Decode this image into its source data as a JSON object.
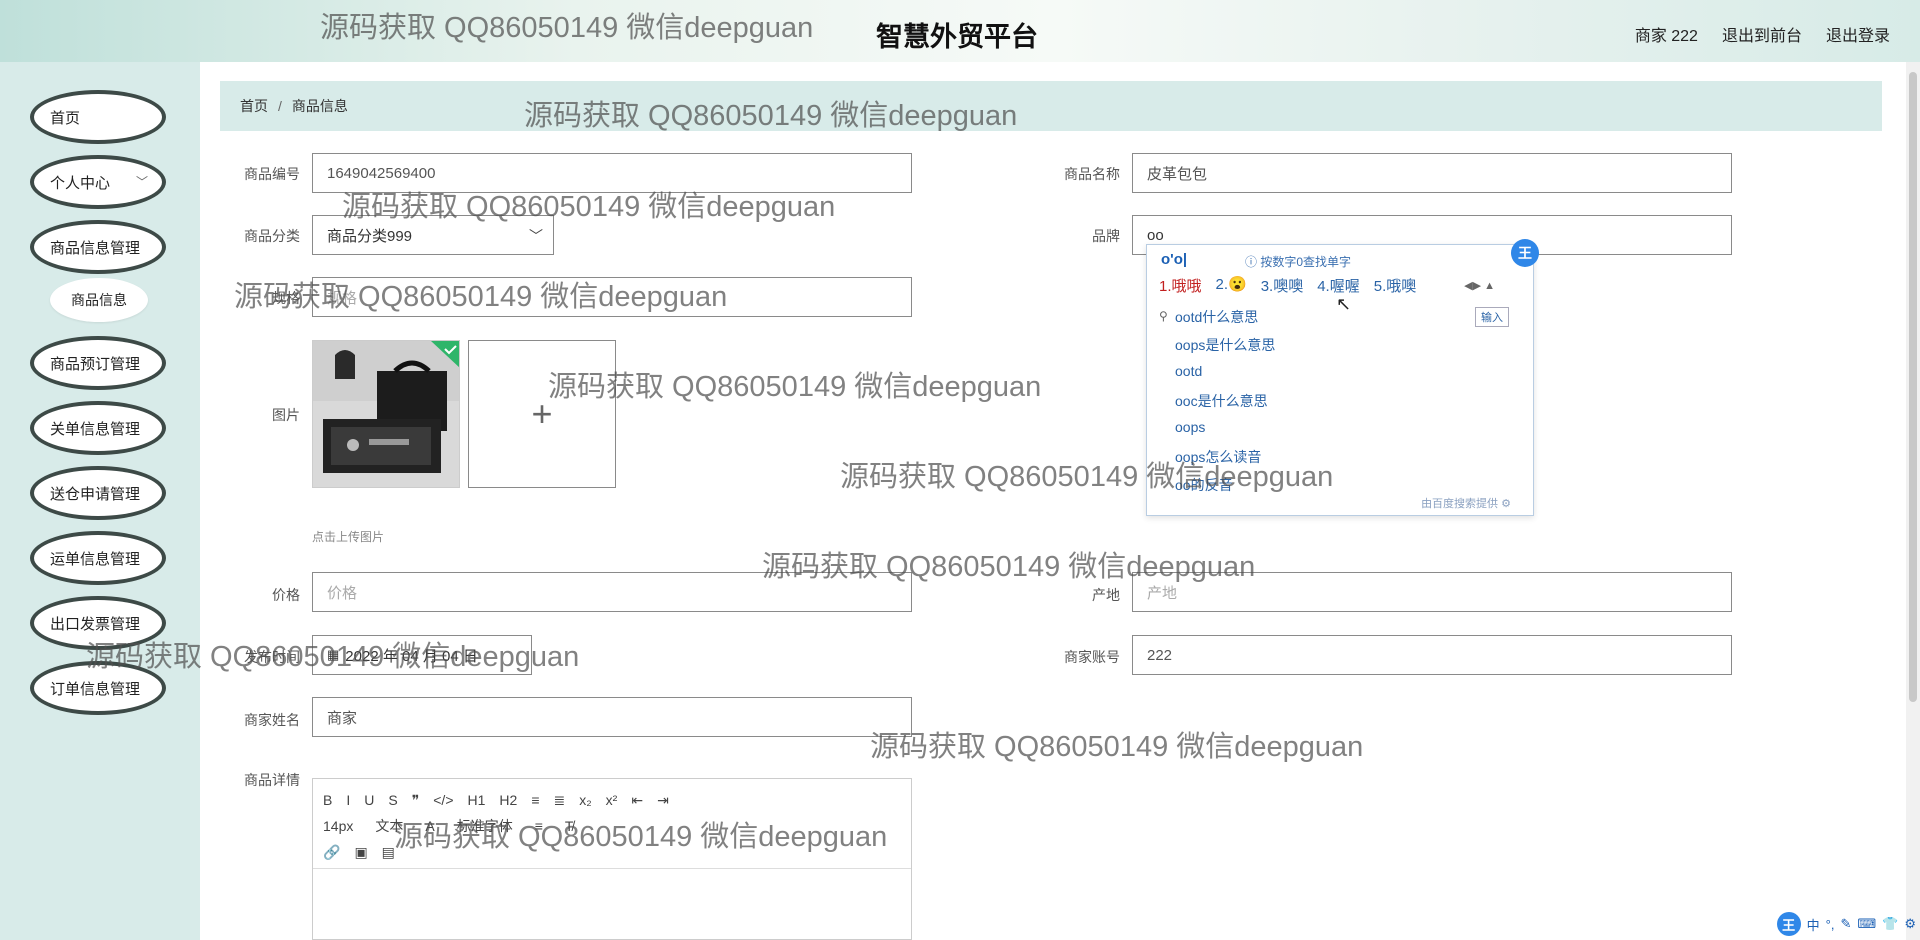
{
  "header": {
    "title": "智慧外贸平台",
    "user": "商家 222",
    "to_front": "退出到前台",
    "logout": "退出登录"
  },
  "sidebar": {
    "items": [
      {
        "label": "首页"
      },
      {
        "label": "个人中心",
        "chevron": "chevron-down-icon"
      },
      {
        "label": "商品信息管理"
      },
      {
        "label": "商品信息",
        "sub": true
      },
      {
        "label": "商品预订管理"
      },
      {
        "label": "关单信息管理"
      },
      {
        "label": "送仓申请管理"
      },
      {
        "label": "运单信息管理"
      },
      {
        "label": "出口发票管理"
      },
      {
        "label": "订单信息管理"
      }
    ]
  },
  "breadcrumb": {
    "home": "首页",
    "sep": "/",
    "current": "商品信息"
  },
  "form": {
    "code_label": "商品编号",
    "code_value": "1649042569400",
    "name_label": "商品名称",
    "name_value": "皮革包包",
    "category_label": "商品分类",
    "category_value": "商品分类999",
    "brand_label": "品牌",
    "brand_value": "oo",
    "spec_label": "规格",
    "spec_placeholder": "规格",
    "image_label": "图片",
    "image_hint": "点击上传图片",
    "price_label": "价格",
    "price_placeholder": "价格",
    "origin_label": "产地",
    "origin_placeholder": "产地",
    "date_label": "发布时间",
    "date_value": "2022 年 04 月 04 日",
    "merchant_account_label": "商家账号",
    "merchant_account_value": "222",
    "merchant_name_label": "商家姓名",
    "merchant_name_value": "商家",
    "detail_label": "商品详情"
  },
  "editor": {
    "row1": [
      "B",
      "I",
      "U",
      "S",
      "❞",
      "</>",
      "H1",
      "H2",
      "≡",
      "≣",
      "x₂",
      "x²",
      "⇤",
      "⇥"
    ],
    "font_size": "14px",
    "text_style": "文本",
    "font_family": "标准字体"
  },
  "ime": {
    "composition": "o'o|",
    "tip": "按数字0查找单字",
    "candidates": [
      "1.哦哦",
      "2.😮",
      "3.噢噢",
      "4.喔喔",
      "5.哦噢"
    ],
    "suggestions": [
      "ootd什么意思",
      "oops是什么意思",
      "ootd",
      "ooc是什么意思",
      "oops",
      "oops怎么读音",
      "oo的反音"
    ],
    "enter": "输入",
    "footer": "由百度搜索提供",
    "badge": "王"
  },
  "imebar": {
    "logo": "王",
    "items": [
      "中",
      "°,",
      "✎",
      "⌨",
      "👕",
      "⚙"
    ]
  },
  "watermark": "源码获取 QQ86050149 微信deepguan"
}
